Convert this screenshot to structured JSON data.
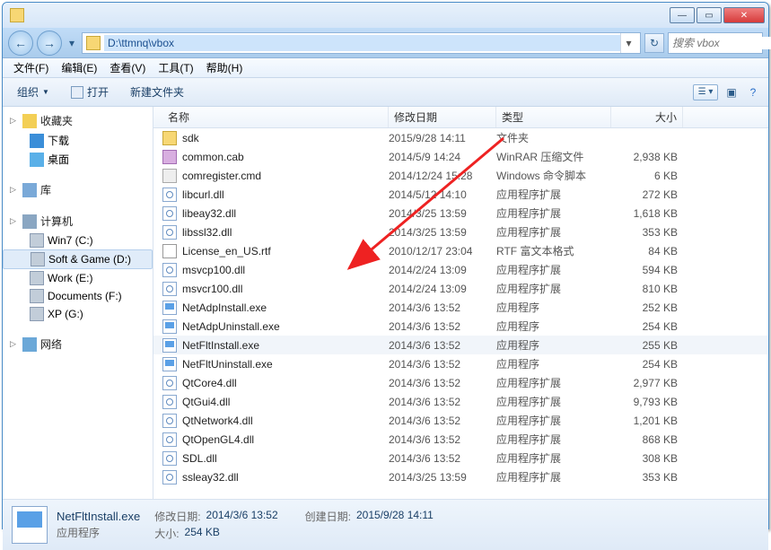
{
  "address": "D:\\ttmnq\\vbox",
  "search_placeholder": "搜索 vbox",
  "menus": {
    "file": "文件(F)",
    "edit": "编辑(E)",
    "view": "查看(V)",
    "tools": "工具(T)",
    "help": "帮助(H)"
  },
  "toolbar": {
    "organize": "组织",
    "open": "打开",
    "newfolder": "新建文件夹"
  },
  "nav": {
    "favorites": "收藏夹",
    "downloads": "下载",
    "desktop": "桌面",
    "libraries": "库",
    "computer": "计算机",
    "c": "Win7 (C:)",
    "d": "Soft & Game (D:)",
    "e": "Work (E:)",
    "f": "Documents (F:)",
    "g": "XP (G:)",
    "network": "网络"
  },
  "cols": {
    "name": "名称",
    "date": "修改日期",
    "type": "类型",
    "size": "大小"
  },
  "files": [
    {
      "ic": "folder",
      "name": "sdk",
      "date": "2015/9/28 14:11",
      "type": "文件夹",
      "size": ""
    },
    {
      "ic": "cab",
      "name": "common.cab",
      "date": "2014/5/9 14:24",
      "type": "WinRAR 压缩文件",
      "size": "2,938 KB"
    },
    {
      "ic": "cmd",
      "name": "comregister.cmd",
      "date": "2014/12/24 15:28",
      "type": "Windows 命令脚本",
      "size": "6 KB"
    },
    {
      "ic": "dll",
      "name": "libcurl.dll",
      "date": "2014/5/12 14:10",
      "type": "应用程序扩展",
      "size": "272 KB"
    },
    {
      "ic": "dll",
      "name": "libeay32.dll",
      "date": "2014/3/25 13:59",
      "type": "应用程序扩展",
      "size": "1,618 KB"
    },
    {
      "ic": "dll",
      "name": "libssl32.dll",
      "date": "2014/3/25 13:59",
      "type": "应用程序扩展",
      "size": "353 KB"
    },
    {
      "ic": "rtf",
      "name": "License_en_US.rtf",
      "date": "2010/12/17 23:04",
      "type": "RTF 富文本格式",
      "size": "84 KB"
    },
    {
      "ic": "dll",
      "name": "msvcp100.dll",
      "date": "2014/2/24 13:09",
      "type": "应用程序扩展",
      "size": "594 KB"
    },
    {
      "ic": "dll",
      "name": "msvcr100.dll",
      "date": "2014/2/24 13:09",
      "type": "应用程序扩展",
      "size": "810 KB"
    },
    {
      "ic": "exe",
      "name": "NetAdpInstall.exe",
      "date": "2014/3/6 13:52",
      "type": "应用程序",
      "size": "252 KB"
    },
    {
      "ic": "exe",
      "name": "NetAdpUninstall.exe",
      "date": "2014/3/6 13:52",
      "type": "应用程序",
      "size": "254 KB"
    },
    {
      "ic": "exe",
      "name": "NetFltInstall.exe",
      "date": "2014/3/6 13:52",
      "type": "应用程序",
      "size": "255 KB",
      "sel": true
    },
    {
      "ic": "exe",
      "name": "NetFltUninstall.exe",
      "date": "2014/3/6 13:52",
      "type": "应用程序",
      "size": "254 KB"
    },
    {
      "ic": "dll",
      "name": "QtCore4.dll",
      "date": "2014/3/6 13:52",
      "type": "应用程序扩展",
      "size": "2,977 KB"
    },
    {
      "ic": "dll",
      "name": "QtGui4.dll",
      "date": "2014/3/6 13:52",
      "type": "应用程序扩展",
      "size": "9,793 KB"
    },
    {
      "ic": "dll",
      "name": "QtNetwork4.dll",
      "date": "2014/3/6 13:52",
      "type": "应用程序扩展",
      "size": "1,201 KB"
    },
    {
      "ic": "dll",
      "name": "QtOpenGL4.dll",
      "date": "2014/3/6 13:52",
      "type": "应用程序扩展",
      "size": "868 KB"
    },
    {
      "ic": "dll",
      "name": "SDL.dll",
      "date": "2014/3/6 13:52",
      "type": "应用程序扩展",
      "size": "308 KB"
    },
    {
      "ic": "dll",
      "name": "ssleay32.dll",
      "date": "2014/3/25 13:59",
      "type": "应用程序扩展",
      "size": "353 KB"
    }
  ],
  "details": {
    "name": "NetFltInstall.exe",
    "type": "应用程序",
    "mod_label": "修改日期:",
    "mod_val": "2014/3/6 13:52",
    "size_label": "大小:",
    "size_val": "254 KB",
    "created_label": "创建日期:",
    "created_val": "2015/9/28 14:11"
  }
}
